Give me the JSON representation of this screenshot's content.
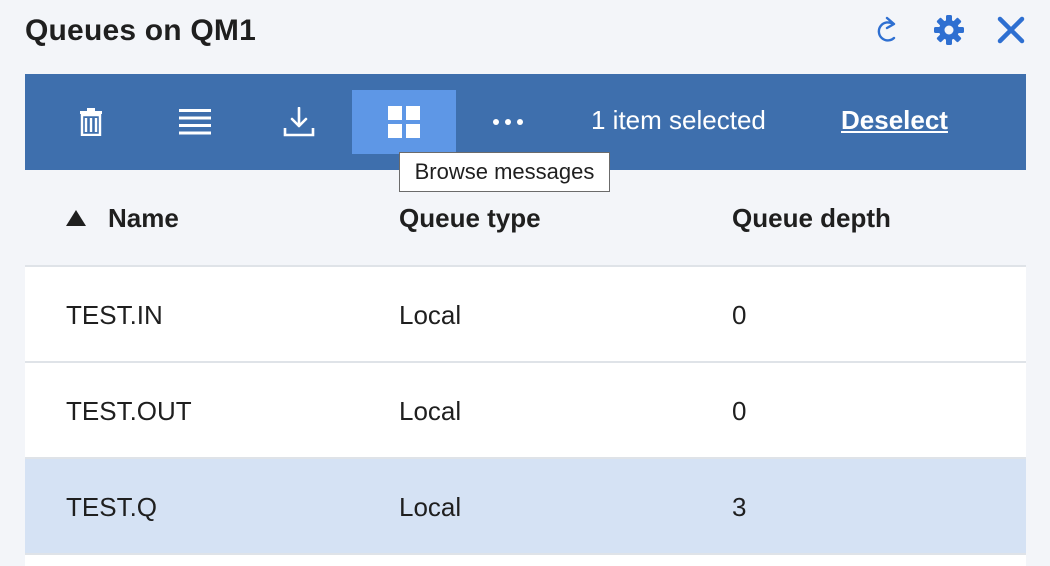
{
  "header": {
    "title": "Queues on QM1",
    "actions": [
      {
        "name": "refresh",
        "icon": "refresh-icon"
      },
      {
        "name": "settings",
        "icon": "gear-icon"
      },
      {
        "name": "close",
        "icon": "close-icon"
      }
    ]
  },
  "toolbar": {
    "buttons": [
      {
        "name": "delete",
        "icon": "trash-icon"
      },
      {
        "name": "properties",
        "icon": "list-icon"
      },
      {
        "name": "download",
        "icon": "download-icon"
      },
      {
        "name": "browse-messages",
        "icon": "grid-icon",
        "active": true
      },
      {
        "name": "more",
        "icon": "overflow-icon"
      }
    ],
    "selected_text": "1 item selected",
    "deselect_label": "Deselect"
  },
  "tooltip": {
    "text": "Browse messages"
  },
  "table": {
    "columns": [
      "Name",
      "Queue type",
      "Queue depth"
    ],
    "sort_indicator": "ascending",
    "rows": [
      {
        "name": "TEST.IN",
        "type": "Local",
        "depth": "0",
        "selected": false
      },
      {
        "name": "TEST.OUT",
        "type": "Local",
        "depth": "0",
        "selected": false
      },
      {
        "name": "TEST.Q",
        "type": "Local",
        "depth": "3",
        "selected": true
      }
    ]
  },
  "colors": {
    "toolbar_bg": "#3e6fad",
    "toolbar_active": "#5e97e6",
    "accent": "#2e6fd1",
    "selected_row": "#d5e2f4",
    "page_bg": "#f3f5f9"
  }
}
